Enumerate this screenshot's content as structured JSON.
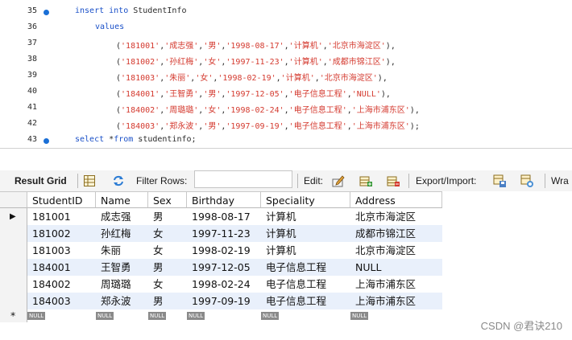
{
  "editor": {
    "lines": [
      {
        "num": "35",
        "breakpoint": true,
        "segments": [
          {
            "t": "insert into ",
            "c": "kw"
          },
          {
            "t": "StudentInfo",
            "c": "pl"
          }
        ]
      },
      {
        "num": "36",
        "breakpoint": false,
        "segments": [
          {
            "t": "values",
            "c": "kw"
          }
        ]
      },
      {
        "num": "37",
        "breakpoint": false,
        "segments": [
          {
            "t": "(",
            "c": "pl"
          },
          {
            "t": "'181001'",
            "c": "str"
          },
          {
            "t": ",",
            "c": "pl"
          },
          {
            "t": "'成志强'",
            "c": "str"
          },
          {
            "t": ",",
            "c": "pl"
          },
          {
            "t": "'男'",
            "c": "str"
          },
          {
            "t": ",",
            "c": "pl"
          },
          {
            "t": "'1998-08-17'",
            "c": "str"
          },
          {
            "t": ",",
            "c": "pl"
          },
          {
            "t": "'计算机'",
            "c": "str"
          },
          {
            "t": ",",
            "c": "pl"
          },
          {
            "t": "'北京市海淀区'",
            "c": "str"
          },
          {
            "t": "),",
            "c": "pl"
          }
        ]
      },
      {
        "num": "38",
        "breakpoint": false,
        "segments": [
          {
            "t": "(",
            "c": "pl"
          },
          {
            "t": "'181002'",
            "c": "str"
          },
          {
            "t": ",",
            "c": "pl"
          },
          {
            "t": "'孙红梅'",
            "c": "str"
          },
          {
            "t": ",",
            "c": "pl"
          },
          {
            "t": "'女'",
            "c": "str"
          },
          {
            "t": ",",
            "c": "pl"
          },
          {
            "t": "'1997-11-23'",
            "c": "str"
          },
          {
            "t": ",",
            "c": "pl"
          },
          {
            "t": "'计算机'",
            "c": "str"
          },
          {
            "t": ",",
            "c": "pl"
          },
          {
            "t": "'成都市锦江区'",
            "c": "str"
          },
          {
            "t": "),",
            "c": "pl"
          }
        ]
      },
      {
        "num": "39",
        "breakpoint": false,
        "segments": [
          {
            "t": "(",
            "c": "pl"
          },
          {
            "t": "'181003'",
            "c": "str"
          },
          {
            "t": ",",
            "c": "pl"
          },
          {
            "t": "'朱丽'",
            "c": "str"
          },
          {
            "t": ",",
            "c": "pl"
          },
          {
            "t": "'女'",
            "c": "str"
          },
          {
            "t": ",",
            "c": "pl"
          },
          {
            "t": "'1998-02-19'",
            "c": "str"
          },
          {
            "t": ",",
            "c": "pl"
          },
          {
            "t": "'计算机'",
            "c": "str"
          },
          {
            "t": ",",
            "c": "pl"
          },
          {
            "t": "'北京市海淀区'",
            "c": "str"
          },
          {
            "t": "),",
            "c": "pl"
          }
        ]
      },
      {
        "num": "40",
        "breakpoint": false,
        "segments": [
          {
            "t": "(",
            "c": "pl"
          },
          {
            "t": "'184001'",
            "c": "str"
          },
          {
            "t": ",",
            "c": "pl"
          },
          {
            "t": "'王智勇'",
            "c": "str"
          },
          {
            "t": ",",
            "c": "pl"
          },
          {
            "t": "'男'",
            "c": "str"
          },
          {
            "t": ",",
            "c": "pl"
          },
          {
            "t": "'1997-12-05'",
            "c": "str"
          },
          {
            "t": ",",
            "c": "pl"
          },
          {
            "t": "'电子信息工程'",
            "c": "str"
          },
          {
            "t": ",",
            "c": "pl"
          },
          {
            "t": "'NULL'",
            "c": "str"
          },
          {
            "t": "),",
            "c": "pl"
          }
        ]
      },
      {
        "num": "41",
        "breakpoint": false,
        "segments": [
          {
            "t": "(",
            "c": "pl"
          },
          {
            "t": "'184002'",
            "c": "str"
          },
          {
            "t": ",",
            "c": "pl"
          },
          {
            "t": "'周璐璐'",
            "c": "str"
          },
          {
            "t": ",",
            "c": "pl"
          },
          {
            "t": "'女'",
            "c": "str"
          },
          {
            "t": ",",
            "c": "pl"
          },
          {
            "t": "'1998-02-24'",
            "c": "str"
          },
          {
            "t": ",",
            "c": "pl"
          },
          {
            "t": "'电子信息工程'",
            "c": "str"
          },
          {
            "t": ",",
            "c": "pl"
          },
          {
            "t": "'上海市浦东区'",
            "c": "str"
          },
          {
            "t": "),",
            "c": "pl"
          }
        ]
      },
      {
        "num": "42",
        "breakpoint": false,
        "segments": [
          {
            "t": "(",
            "c": "pl"
          },
          {
            "t": "'184003'",
            "c": "str"
          },
          {
            "t": ",",
            "c": "pl"
          },
          {
            "t": "'郑永波'",
            "c": "str"
          },
          {
            "t": ",",
            "c": "pl"
          },
          {
            "t": "'男'",
            "c": "str"
          },
          {
            "t": ",",
            "c": "pl"
          },
          {
            "t": "'1997-09-19'",
            "c": "str"
          },
          {
            "t": ",",
            "c": "pl"
          },
          {
            "t": "'电子信息工程'",
            "c": "str"
          },
          {
            "t": ",",
            "c": "pl"
          },
          {
            "t": "'上海市浦东区'",
            "c": "str"
          },
          {
            "t": ");",
            "c": "pl"
          }
        ]
      },
      {
        "num": "43",
        "breakpoint": true,
        "segments": [
          {
            "t": "select ",
            "c": "kw"
          },
          {
            "t": "*",
            "c": "pl"
          },
          {
            "t": "from ",
            "c": "kw"
          },
          {
            "t": "studentinfo;",
            "c": "pl"
          }
        ]
      }
    ]
  },
  "toolbar": {
    "result_grid": "Result Grid",
    "filter_rows": "Filter Rows:",
    "filter_value": "",
    "edit": "Edit:",
    "export_import": "Export/Import:",
    "wrap": "Wra"
  },
  "grid": {
    "columns": [
      "StudentID",
      "Name",
      "Sex",
      "Birthday",
      "Speciality",
      "Address"
    ],
    "rows": [
      [
        "181001",
        "成志强",
        "男",
        "1998-08-17",
        "计算机",
        "北京市海淀区"
      ],
      [
        "181002",
        "孙红梅",
        "女",
        "1997-11-23",
        "计算机",
        "成都市锦江区"
      ],
      [
        "181003",
        "朱丽",
        "女",
        "1998-02-19",
        "计算机",
        "北京市海淀区"
      ],
      [
        "184001",
        "王智勇",
        "男",
        "1997-12-05",
        "电子信息工程",
        "NULL"
      ],
      [
        "184002",
        "周璐璐",
        "女",
        "1998-02-24",
        "电子信息工程",
        "上海市浦东区"
      ],
      [
        "184003",
        "郑永波",
        "男",
        "1997-09-19",
        "电子信息工程",
        "上海市浦东区"
      ]
    ],
    "current_row_marker": "▶",
    "new_row_marker": "*",
    "null_badge": "NULL",
    "colors": {
      "row_even": "#ffffff",
      "row_odd": "#e9f0fb",
      "badge": "#8a8a8a"
    }
  },
  "watermark": "CSDN @君诀210"
}
